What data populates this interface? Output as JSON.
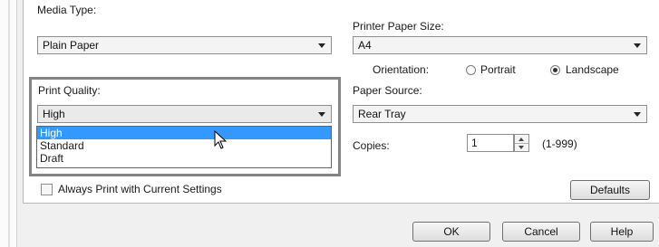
{
  "media_type": {
    "label": "Media Type:",
    "value": "Plain Paper"
  },
  "printer_paper_size": {
    "label": "Printer Paper Size:",
    "value": "A4"
  },
  "orientation": {
    "label": "Orientation:",
    "portrait": "Portrait",
    "landscape": "Landscape",
    "selected": "Landscape"
  },
  "print_quality": {
    "label": "Print Quality:",
    "value": "High",
    "options": [
      "High",
      "Standard",
      "Draft"
    ],
    "highlighted": "High"
  },
  "paper_source": {
    "label": "Paper Source:",
    "value": "Rear Tray"
  },
  "copies": {
    "label": "Copies:",
    "value": "1",
    "range": "(1-999)"
  },
  "always_print": {
    "label": "Always Print with Current Settings",
    "checked": false
  },
  "buttons": {
    "defaults": "Defaults",
    "ok": "OK",
    "cancel": "Cancel",
    "help": "Help"
  },
  "colors": {
    "selection": "#3399ff",
    "highlight_border": "#858585"
  }
}
